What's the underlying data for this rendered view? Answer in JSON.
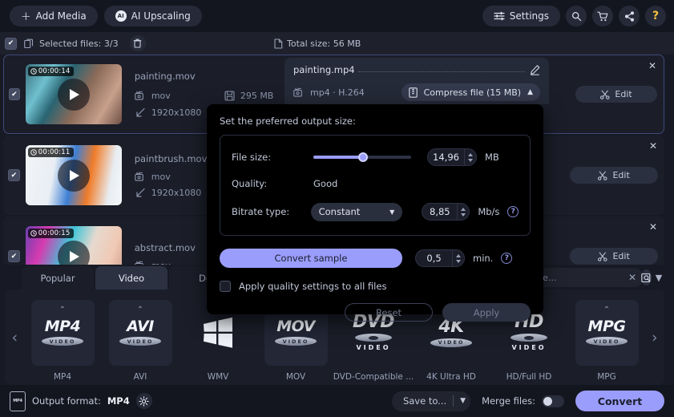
{
  "topbar": {
    "add_media": "Add Media",
    "ai_upscaling": "AI Upscaling",
    "settings": "Settings",
    "icons": [
      "search-icon",
      "cart-icon",
      "share-icon",
      "help-icon"
    ]
  },
  "subbar": {
    "selected_files": "Selected files: 3/3",
    "total_size": "Total size: 56 MB"
  },
  "files": [
    {
      "name": "painting.mov",
      "duration": "00:00:14",
      "format": "mov",
      "size": "295 MB",
      "resolution": "1920x1080",
      "edit": "Edit"
    },
    {
      "name": "paintbrush.mov",
      "duration": "00:00:11",
      "format": "mov",
      "size": "",
      "resolution": "1920x1080",
      "edit": "Edit"
    },
    {
      "name": "abstract.mov",
      "duration": "00:00:15",
      "format": "mov",
      "size": "",
      "resolution": "",
      "edit": "Edit"
    }
  ],
  "output_panel": {
    "filename": "painting.mp4",
    "codec": "mp4 · H.264",
    "compress_label": "Compress file (15 MB)"
  },
  "dialog": {
    "title": "Set the preferred output size:",
    "file_size_label": "File size:",
    "file_size_value": "14,96",
    "file_size_unit": "MB",
    "quality_label": "Quality:",
    "quality_value": "Good",
    "bitrate_label": "Bitrate type:",
    "bitrate_mode": "Constant",
    "bitrate_value": "8,85",
    "bitrate_unit": "Mb/s",
    "convert_sample": "Convert sample",
    "sample_value": "0,5",
    "sample_unit": "min.",
    "apply_all": "Apply quality settings to all files",
    "reset": "Reset",
    "apply": "Apply"
  },
  "tabs": [
    {
      "label": "Popular",
      "active": false
    },
    {
      "label": "Video",
      "active": true
    },
    {
      "label": "De",
      "active": false
    }
  ],
  "search": {
    "value": "or device...",
    "placeholder": "or device..."
  },
  "presets": [
    {
      "label": "MP4",
      "logo": "MP4",
      "sub": "VIDEO",
      "caret": true,
      "type": "text"
    },
    {
      "label": "AVI",
      "logo": "AVI",
      "sub": "VIDEO",
      "caret": true,
      "type": "text"
    },
    {
      "label": "WMV",
      "logo": "",
      "sub": "",
      "caret": false,
      "type": "windows"
    },
    {
      "label": "MOV",
      "logo": "MOV",
      "sub": "VIDEO",
      "caret": false,
      "type": "text"
    },
    {
      "label": "DVD-Compatible ...",
      "logo": "DVD",
      "sub": "VIDEO",
      "below": "VIDEO",
      "caret": false,
      "type": "text-below"
    },
    {
      "label": "4K Ultra HD",
      "logo": "4K",
      "sub": "VIDEO",
      "caret": false,
      "type": "text"
    },
    {
      "label": "HD/Full HD",
      "logo": "HD",
      "sub": "VIDEO",
      "below": "VIDEO",
      "caret": false,
      "type": "text-below"
    },
    {
      "label": "MPG",
      "logo": "MPG",
      "sub": "VIDEO",
      "caret": true,
      "type": "text"
    }
  ],
  "bottom": {
    "output_format_label": "Output format:",
    "output_format_value": "MP4",
    "file_badge": "MP4",
    "save_to": "Save to...",
    "merge_files": "Merge files:",
    "convert": "Convert"
  },
  "colors": {
    "accent": "#9a9dfb",
    "panel": "#1b1e29",
    "background": "#171a24",
    "dialog_bg": "#000000",
    "help_yellow": "#f5c33b"
  }
}
